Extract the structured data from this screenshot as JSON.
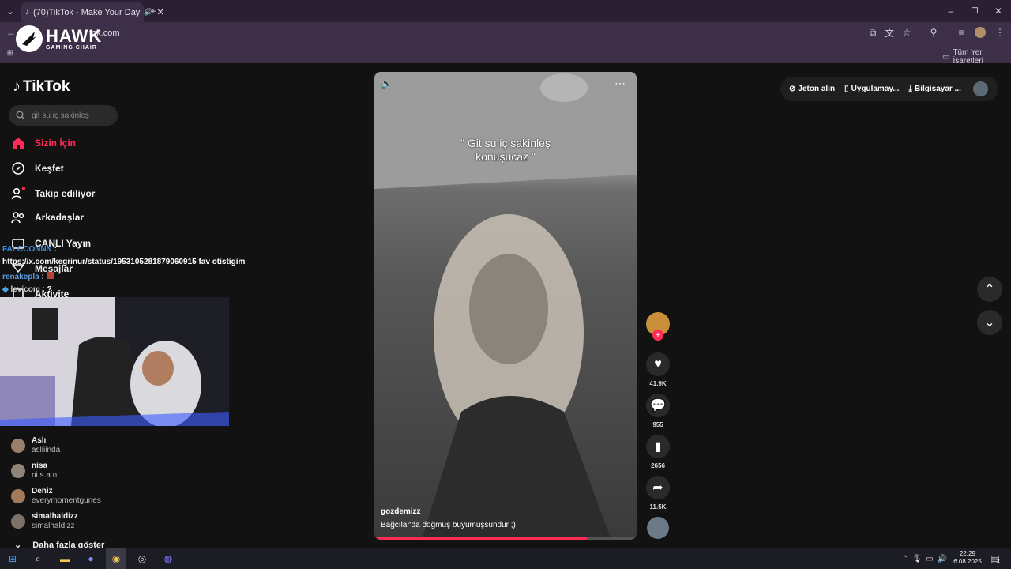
{
  "browser": {
    "tab_title": "(70)TikTok - Make Your Day",
    "url_suffix": "tok.com",
    "bookmarks_label": "Tüm Yer İşaretleri"
  },
  "overlay": {
    "brand_name": "HAWK",
    "brand_sub": "GAMING CHAIR"
  },
  "tiktok": {
    "logo": "TikTok",
    "search_placeholder": "git su iç sakinleş",
    "nav": [
      {
        "label": "Sizin İçin"
      },
      {
        "label": "Keşfet"
      },
      {
        "label": "Takip ediliyor"
      },
      {
        "label": "Arkadaşlar"
      },
      {
        "label": "CANLI Yayın"
      },
      {
        "label": "Mesajlar"
      },
      {
        "label": "Aktivite"
      }
    ],
    "header_actions": {
      "coins": "Jeton alın",
      "app": "Uygulamay...",
      "pc": "Bilgisayar ..."
    },
    "following": [
      {
        "name": "Aslı",
        "handle": "asliiinda"
      },
      {
        "name": "nisa",
        "handle": "ni.s.a.n"
      },
      {
        "name": "Deniz",
        "handle": "everymomentgunes"
      },
      {
        "name": "simalhaldizz",
        "handle": "simalhaldizz"
      }
    ],
    "show_more": "Daha fazla göster",
    "video": {
      "caption_line1": "\" Git su iç sakinleş",
      "caption_line2": "konuşucaz \"",
      "author": "gozdemizz",
      "description": "Bağcılar'da doğmuş büyümüşsündür ;)",
      "progress": 0.81
    },
    "actions": {
      "likes": "41.9K",
      "comments": "955",
      "saves": "2656",
      "shares": "11.5K"
    }
  },
  "chat": {
    "line1_user": "FALCCONNN",
    "line1_colon": ":",
    "line2": "https://x.com/kegrinur/status/1953105281879060915 fav otistigim",
    "line3_user": "renakepla",
    "line3_colon": ":",
    "line4_user": "levicom",
    "line4_text": ": ?"
  },
  "taskbar": {
    "time": "22:29",
    "date": "6.08.2025",
    "badge": "2"
  }
}
